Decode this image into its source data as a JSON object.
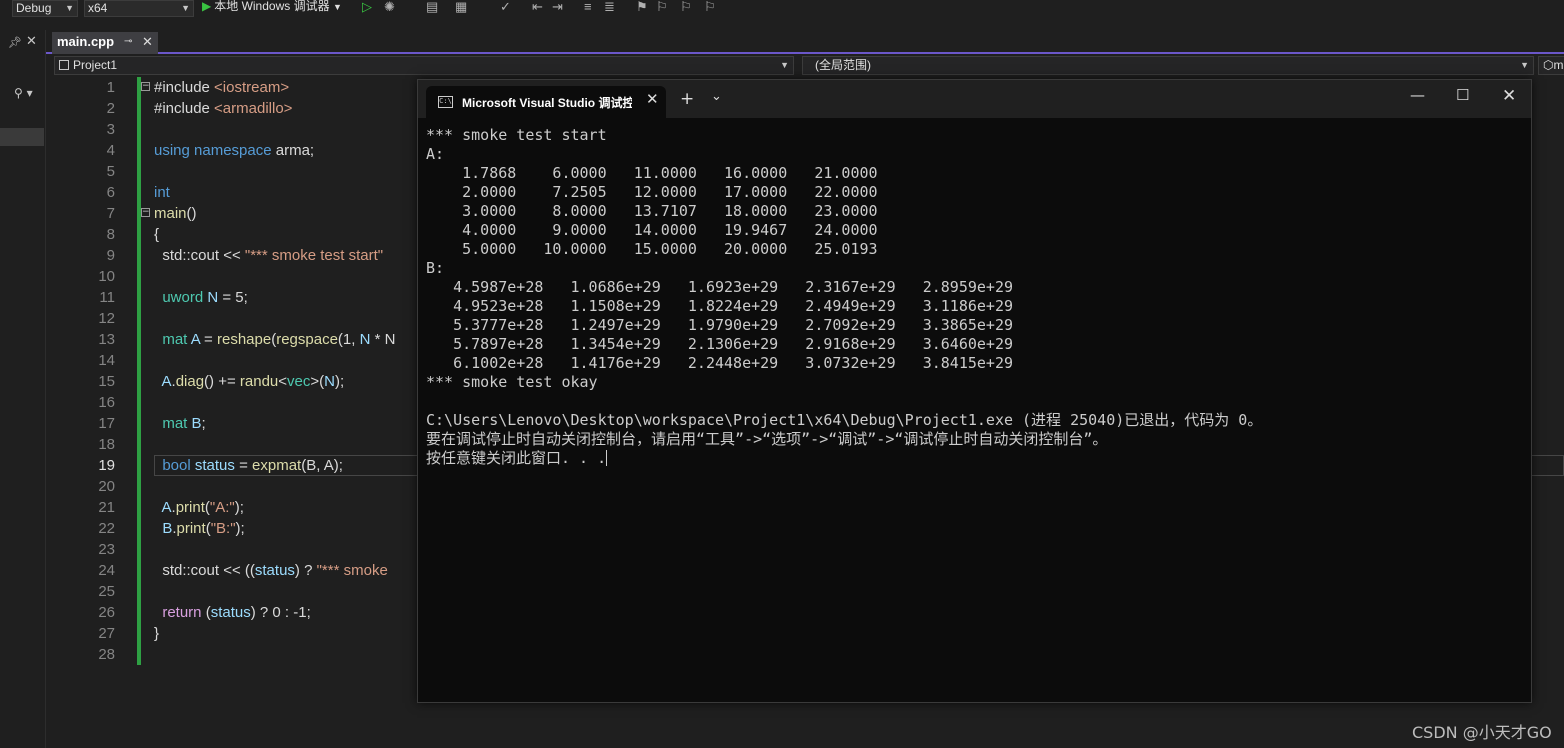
{
  "toolbar": {
    "config": "Debug",
    "platform": "x64",
    "run_label": "本地 Windows 调试器"
  },
  "tab": {
    "file": "main.cpp"
  },
  "navbar": {
    "project": "Project1",
    "scope": "(全局范围)",
    "member": "m"
  },
  "editor": {
    "active_line": 19,
    "lines": [
      [
        {
          "t": "#include ",
          "c": ""
        },
        {
          "t": "<iostream>",
          "c": "inc"
        }
      ],
      [
        {
          "t": "#include ",
          "c": ""
        },
        {
          "t": "<armadillo>",
          "c": "inc"
        }
      ],
      [],
      [
        {
          "t": "using namespace",
          "c": "kw"
        },
        {
          "t": " arma;",
          "c": ""
        }
      ],
      [],
      [
        {
          "t": "int",
          "c": "kw"
        }
      ],
      [
        {
          "t": "main",
          "c": "fn"
        },
        {
          "t": "()",
          "c": ""
        }
      ],
      [
        {
          "t": "{",
          "c": ""
        }
      ],
      [
        {
          "t": "  std::cout << ",
          "c": ""
        },
        {
          "t": "\"*** smoke test start\"",
          "c": "st"
        }
      ],
      [],
      [
        {
          "t": "  uword ",
          "c": "ty"
        },
        {
          "t": "N",
          "c": "vr"
        },
        {
          "t": " = 5;",
          "c": ""
        }
      ],
      [],
      [
        {
          "t": "  mat ",
          "c": "ty"
        },
        {
          "t": "A",
          "c": "vr"
        },
        {
          "t": " = ",
          "c": ""
        },
        {
          "t": "reshape",
          "c": "fn"
        },
        {
          "t": "(",
          "c": ""
        },
        {
          "t": "regspace",
          "c": "fn"
        },
        {
          "t": "(1, ",
          "c": ""
        },
        {
          "t": "N",
          "c": "vr"
        },
        {
          "t": " * N",
          "c": ""
        }
      ],
      [],
      [
        {
          "t": "  A",
          "c": "vr"
        },
        {
          "t": ".",
          "c": ""
        },
        {
          "t": "diag",
          "c": "fn"
        },
        {
          "t": "() += ",
          "c": ""
        },
        {
          "t": "randu",
          "c": "fn"
        },
        {
          "t": "<",
          "c": ""
        },
        {
          "t": "vec",
          "c": "ty"
        },
        {
          "t": ">(",
          "c": ""
        },
        {
          "t": "N",
          "c": "vr"
        },
        {
          "t": ");",
          "c": ""
        }
      ],
      [],
      [
        {
          "t": "  mat ",
          "c": "ty"
        },
        {
          "t": "B",
          "c": "vr"
        },
        {
          "t": ";",
          "c": ""
        }
      ],
      [],
      [
        {
          "t": "  bool ",
          "c": "kw"
        },
        {
          "t": "status",
          "c": "vr"
        },
        {
          "t": " = ",
          "c": ""
        },
        {
          "t": "expmat",
          "c": "fn"
        },
        {
          "t": "(B, A);",
          "c": ""
        }
      ],
      [],
      [
        {
          "t": "  A",
          "c": "vr"
        },
        {
          "t": ".",
          "c": ""
        },
        {
          "t": "print",
          "c": "fn"
        },
        {
          "t": "(",
          "c": ""
        },
        {
          "t": "\"A:\"",
          "c": "st"
        },
        {
          "t": ");",
          "c": ""
        }
      ],
      [
        {
          "t": "  B",
          "c": "vr"
        },
        {
          "t": ".",
          "c": ""
        },
        {
          "t": "print",
          "c": "fn"
        },
        {
          "t": "(",
          "c": ""
        },
        {
          "t": "\"B:\"",
          "c": "st"
        },
        {
          "t": ");",
          "c": ""
        }
      ],
      [],
      [
        {
          "t": "  std::cout << ((",
          "c": ""
        },
        {
          "t": "status",
          "c": "vr"
        },
        {
          "t": ") ? ",
          "c": ""
        },
        {
          "t": "\"*** smoke",
          "c": "st"
        }
      ],
      [],
      [
        {
          "t": "  return",
          "c": "cf"
        },
        {
          "t": " (",
          "c": ""
        },
        {
          "t": "status",
          "c": "vr"
        },
        {
          "t": ") ? 0 : -1;",
          "c": ""
        }
      ],
      [
        {
          "t": "}",
          "c": ""
        }
      ],
      []
    ]
  },
  "console": {
    "title": "Microsoft Visual Studio 调试控制台",
    "lines": [
      "*** smoke test start",
      "A:",
      "    1.7868    6.0000   11.0000   16.0000   21.0000",
      "    2.0000    7.2505   12.0000   17.0000   22.0000",
      "    3.0000    8.0000   13.7107   18.0000   23.0000",
      "    4.0000    9.0000   14.0000   19.9467   24.0000",
      "    5.0000   10.0000   15.0000   20.0000   25.0193",
      "B:",
      "   4.5987e+28   1.0686e+29   1.6923e+29   2.3167e+29   2.8959e+29",
      "   4.9523e+28   1.1508e+29   1.8224e+29   2.4949e+29   3.1186e+29",
      "   5.3777e+28   1.2497e+29   1.9790e+29   2.7092e+29   3.3865e+29",
      "   5.7897e+28   1.3454e+29   2.1306e+29   2.9168e+29   3.6460e+29",
      "   6.1002e+28   1.4176e+29   2.2448e+29   3.0732e+29   3.8415e+29",
      "*** smoke test okay",
      "",
      "C:\\Users\\Lenovo\\Desktop\\workspace\\Project1\\x64\\Debug\\Project1.exe (进程 25040)已退出，代码为 0。",
      "要在调试停止时自动关闭控制台，请启用“工具”->“选项”->“调试”->“调试停止时自动关闭控制台”。",
      "按任意键关闭此窗口. . ."
    ]
  },
  "watermark": "CSDN @小天才GO"
}
